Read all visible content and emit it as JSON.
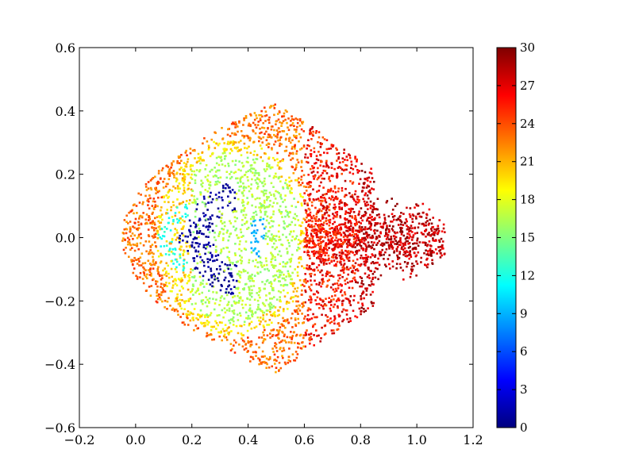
{
  "chart_data": {
    "type": "scatter",
    "title": "",
    "xlabel": "",
    "ylabel": "",
    "xlim": [
      -0.2,
      1.2
    ],
    "ylim": [
      -0.6,
      0.6
    ],
    "x_ticks": [
      -0.2,
      0.0,
      0.2,
      0.4,
      0.6,
      0.8,
      1.0,
      1.2
    ],
    "x_tick_labels": [
      "−0.2",
      "0.0",
      "0.2",
      "0.4",
      "0.6",
      "0.8",
      "1.0",
      "1.2"
    ],
    "y_ticks": [
      -0.6,
      -0.4,
      -0.2,
      0.0,
      0.2,
      0.4,
      0.6
    ],
    "y_tick_labels": [
      "−0.6",
      "−0.4",
      "−0.2",
      "0.0",
      "0.2",
      "0.4",
      "0.6"
    ],
    "grid": false,
    "colormap": "jet",
    "colorbar": {
      "range": [
        0,
        30
      ],
      "ticks": [
        0,
        3,
        6,
        9,
        12,
        15,
        18,
        21,
        24,
        27,
        30
      ],
      "tick_labels": [
        "0",
        "3",
        "6",
        "9",
        "12",
        "15",
        "18",
        "21",
        "24",
        "27",
        "30"
      ],
      "placement": "right"
    },
    "color_stops": [
      "#00007f",
      "#0000ff",
      "#007fff",
      "#00ffff",
      "#7fff7f",
      "#ffff00",
      "#ff7f00",
      "#ff0000",
      "#7f0000"
    ],
    "region_summary": {
      "extent_x": [
        -0.05,
        1.1
      ],
      "extent_y": [
        -0.43,
        0.43
      ],
      "dark_blue_crescent": {
        "center": [
          0.33,
          0.0
        ],
        "radius_outer": 0.19,
        "value": 0
      },
      "cyan_arc_left": {
        "center": [
          0.16,
          0.0
        ],
        "radius": 0.09,
        "value": 11
      },
      "cyan_crescent_small": {
        "center": [
          0.43,
          0.0
        ],
        "value": 9
      },
      "green_band": {
        "x_range": [
          0.2,
          0.58
        ],
        "value": 16
      },
      "orange_rim": {
        "value": 23
      },
      "red_fringe": {
        "x_range": [
          0.58,
          1.1
        ],
        "value": 27
      }
    }
  }
}
